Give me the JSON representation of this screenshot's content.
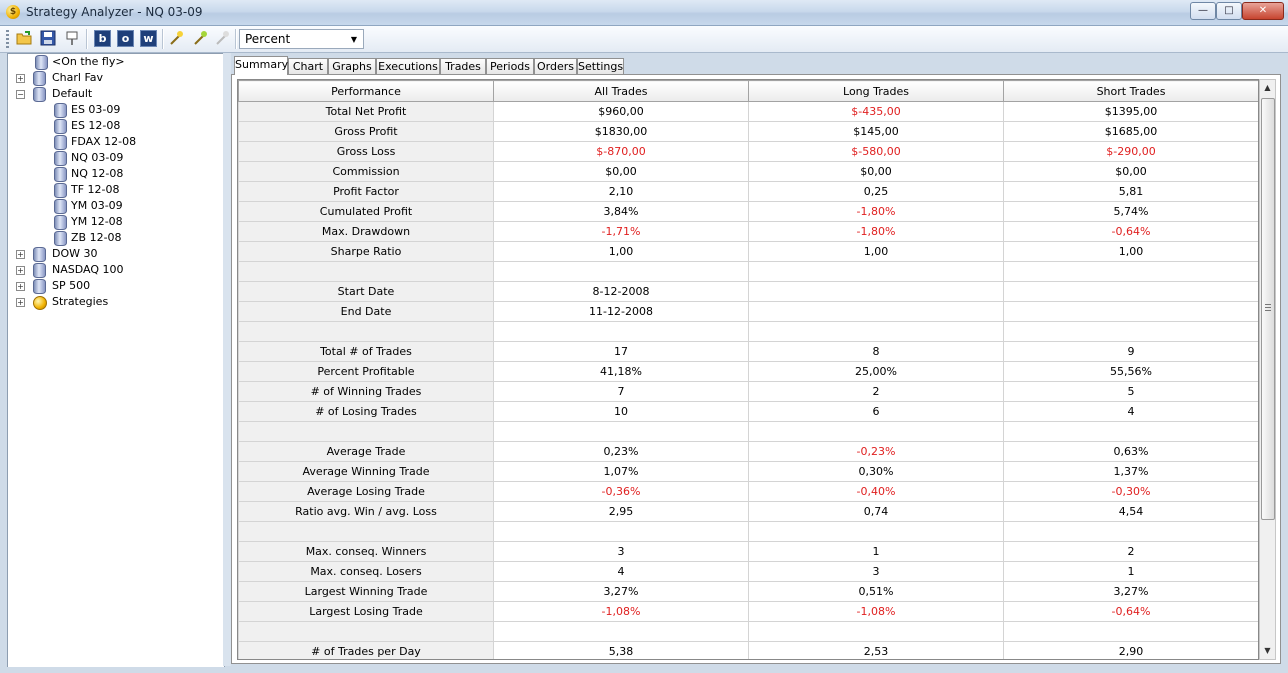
{
  "window": {
    "title": "Strategy Analyzer - NQ 03-09",
    "app_icon_glyph": "$",
    "minimize_glyph": "—",
    "maximize_glyph": "□",
    "close_glyph": "✕"
  },
  "toolbar": {
    "letter_buttons": [
      "b",
      "o",
      "w"
    ],
    "mode_select": {
      "value": "Percent",
      "arrow": "▼"
    }
  },
  "tree": {
    "on_the_fly": "<On the fly>",
    "charl_fav": "Charl Fav",
    "default": "Default",
    "default_children": [
      "ES 03-09",
      "ES 12-08",
      "FDAX 12-08",
      "NQ 03-09",
      "NQ 12-08",
      "TF 12-08",
      "YM 03-09",
      "YM 12-08",
      "ZB 12-08"
    ],
    "dow": "DOW 30",
    "nasdaq": "NASDAQ 100",
    "sp500": "SP 500",
    "strategies": "Strategies",
    "expand_glyph": "+",
    "collapse_glyph": "−"
  },
  "tabs": [
    "Summary",
    "Chart",
    "Graphs",
    "Executions",
    "Trades",
    "Periods",
    "Orders",
    "Settings"
  ],
  "grid": {
    "headers": [
      "Performance",
      "All Trades",
      "Long Trades",
      "Short Trades"
    ],
    "rows": [
      [
        "Total Net Profit",
        "$960,00",
        "$-435,00",
        "$1395,00"
      ],
      [
        "Gross Profit",
        "$1830,00",
        "$145,00",
        "$1685,00"
      ],
      [
        "Gross Loss",
        "$-870,00",
        "$-580,00",
        "$-290,00"
      ],
      [
        "Commission",
        "$0,00",
        "$0,00",
        "$0,00"
      ],
      [
        "Profit Factor",
        "2,10",
        "0,25",
        "5,81"
      ],
      [
        "Cumulated Profit",
        "3,84%",
        "-1,80%",
        "5,74%"
      ],
      [
        "Max. Drawdown",
        "-1,71%",
        "-1,80%",
        "-0,64%"
      ],
      [
        "Sharpe Ratio",
        "1,00",
        "1,00",
        "1,00"
      ],
      [
        "",
        "",
        "",
        ""
      ],
      [
        "Start Date",
        "8-12-2008",
        "",
        ""
      ],
      [
        "End Date",
        "11-12-2008",
        "",
        ""
      ],
      [
        "",
        "",
        "",
        ""
      ],
      [
        "Total # of Trades",
        "17",
        "8",
        "9"
      ],
      [
        "Percent Profitable",
        "41,18%",
        "25,00%",
        "55,56%"
      ],
      [
        "# of Winning Trades",
        "7",
        "2",
        "5"
      ],
      [
        "# of Losing Trades",
        "10",
        "6",
        "4"
      ],
      [
        "",
        "",
        "",
        ""
      ],
      [
        "Average Trade",
        "0,23%",
        "-0,23%",
        "0,63%"
      ],
      [
        "Average Winning Trade",
        "1,07%",
        "0,30%",
        "1,37%"
      ],
      [
        "Average Losing Trade",
        "-0,36%",
        "-0,40%",
        "-0,30%"
      ],
      [
        "Ratio avg. Win / avg. Loss",
        "2,95",
        "0,74",
        "4,54"
      ],
      [
        "",
        "",
        "",
        ""
      ],
      [
        "Max. conseq. Winners",
        "3",
        "1",
        "2"
      ],
      [
        "Max. conseq. Losers",
        "4",
        "3",
        "1"
      ],
      [
        "Largest Winning Trade",
        "3,27%",
        "0,51%",
        "3,27%"
      ],
      [
        "Largest Losing Trade",
        "-1,08%",
        "-1,08%",
        "-0,64%"
      ],
      [
        "",
        "",
        "",
        ""
      ],
      [
        "# of Trades per Day",
        "5,38",
        "2,53",
        "2,90"
      ]
    ]
  },
  "scrollbar": {
    "up": "▲",
    "down": "▼"
  },
  "colors": {
    "negative": "#e02020"
  }
}
